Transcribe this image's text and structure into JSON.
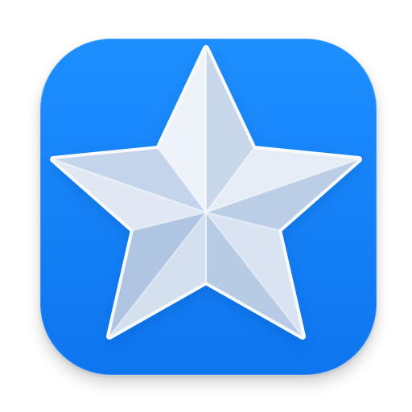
{
  "app_icon": {
    "icon": "star-icon",
    "colors": {
      "background": "#1487F7",
      "background_edge": "#0B6FE3",
      "star_light": "#EAF0F8",
      "star_mid": "#C7D5E8",
      "star_dark": "#9CB5D6",
      "star_outline": "#F7FAFF"
    }
  }
}
